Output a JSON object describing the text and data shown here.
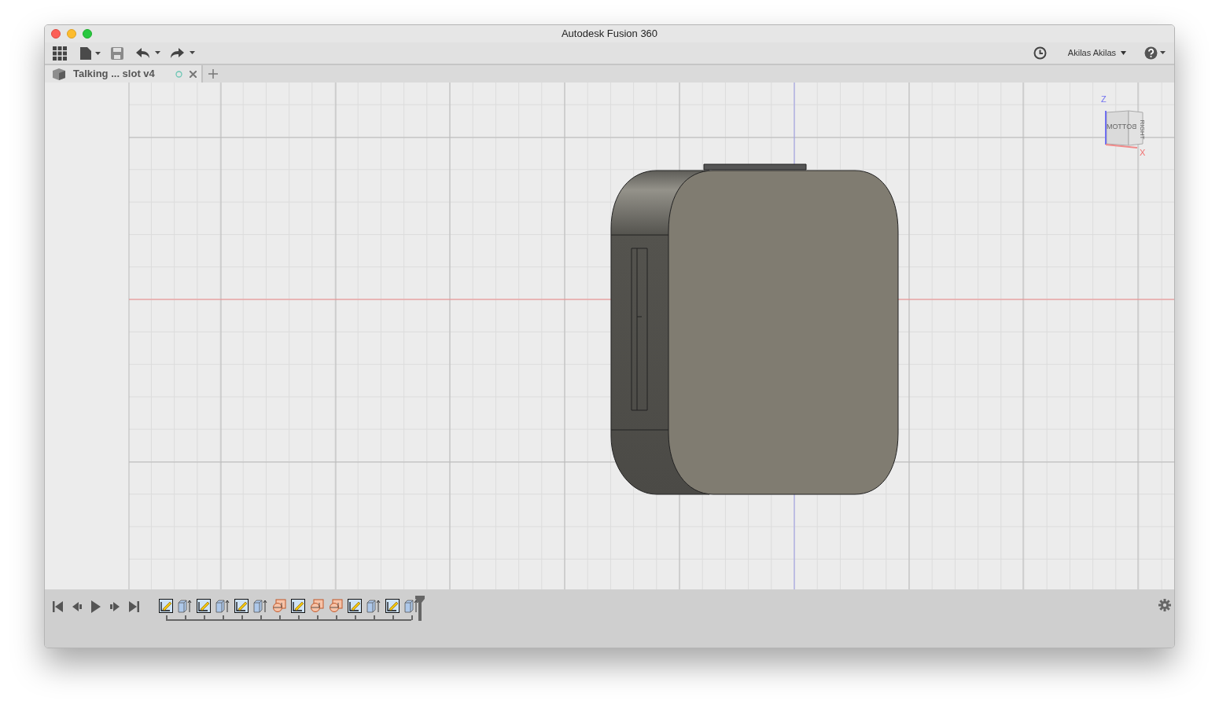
{
  "window": {
    "title": "Autodesk Fusion 360"
  },
  "toolbar": {
    "user": "Akilas Akilas"
  },
  "tabs": [
    {
      "label": "Talking ... slot v4"
    }
  ],
  "view_cube": {
    "top_axis": "Z",
    "side_axis": "X",
    "front_face": "BOTTOM",
    "side_face": "RIGHT"
  },
  "timeline": {
    "features": [
      {
        "kind": "sketch"
      },
      {
        "kind": "extrude"
      },
      {
        "kind": "sketch"
      },
      {
        "kind": "extrude"
      },
      {
        "kind": "sketch"
      },
      {
        "kind": "extrude"
      },
      {
        "kind": "fillet"
      },
      {
        "kind": "sketch"
      },
      {
        "kind": "fillet"
      },
      {
        "kind": "fillet"
      },
      {
        "kind": "sketch"
      },
      {
        "kind": "extrude"
      },
      {
        "kind": "sketch"
      },
      {
        "kind": "extrude"
      }
    ]
  }
}
